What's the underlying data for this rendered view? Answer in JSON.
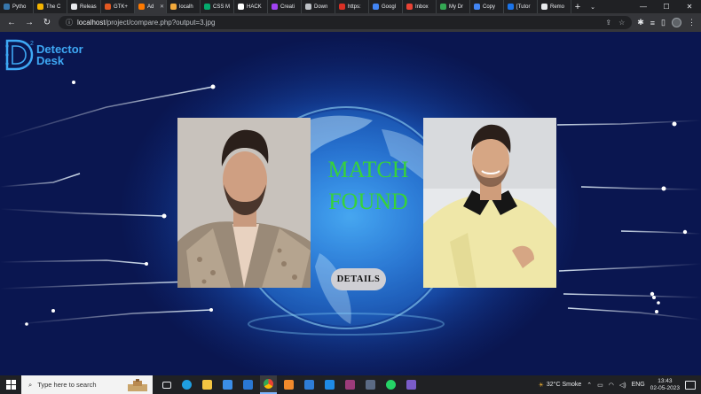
{
  "browser": {
    "tabs": [
      {
        "label": "Pytho",
        "color": "#3776ab"
      },
      {
        "label": "The C",
        "color": "#f4b400"
      },
      {
        "label": "Releas",
        "color": "#e8eaed"
      },
      {
        "label": "GTK+",
        "color": "#e25822"
      },
      {
        "label": "Ad",
        "color": "#ff7a00",
        "active": true
      },
      {
        "label": "localh",
        "color": "#f2a93b"
      },
      {
        "label": "CSS M",
        "color": "#04aa6d"
      },
      {
        "label": "HACK",
        "color": "#ffffff"
      },
      {
        "label": "Creati",
        "color": "#a142f4"
      },
      {
        "label": "Down",
        "color": "#bdc1c6"
      },
      {
        "label": "https:",
        "color": "#d93025"
      },
      {
        "label": "Googl",
        "color": "#4285f4"
      },
      {
        "label": "Inbox",
        "color": "#ea4335"
      },
      {
        "label": "My Dr",
        "color": "#34a853"
      },
      {
        "label": "Copy",
        "color": "#4285f4"
      },
      {
        "label": "[Tutor",
        "color": "#1a73e8"
      },
      {
        "label": "Remo",
        "color": "#e8eaed"
      }
    ],
    "new_tab": "+",
    "url_host": "localhost",
    "url_path": "/project/compare.php?output=3.jpg"
  },
  "page": {
    "logo_line1": "Detector",
    "logo_line2": "Desk",
    "result_line1": "MATCH",
    "result_line2": "FOUND",
    "details_label": "DETAILS",
    "colors": {
      "accent": "#37d23a",
      "logo": "#3ea8f4"
    }
  },
  "taskbar": {
    "search_placeholder": "Type here to search",
    "weather": "32°C  Smoke",
    "language": "ENG",
    "time": "13:43",
    "date": "02-05-2023"
  }
}
